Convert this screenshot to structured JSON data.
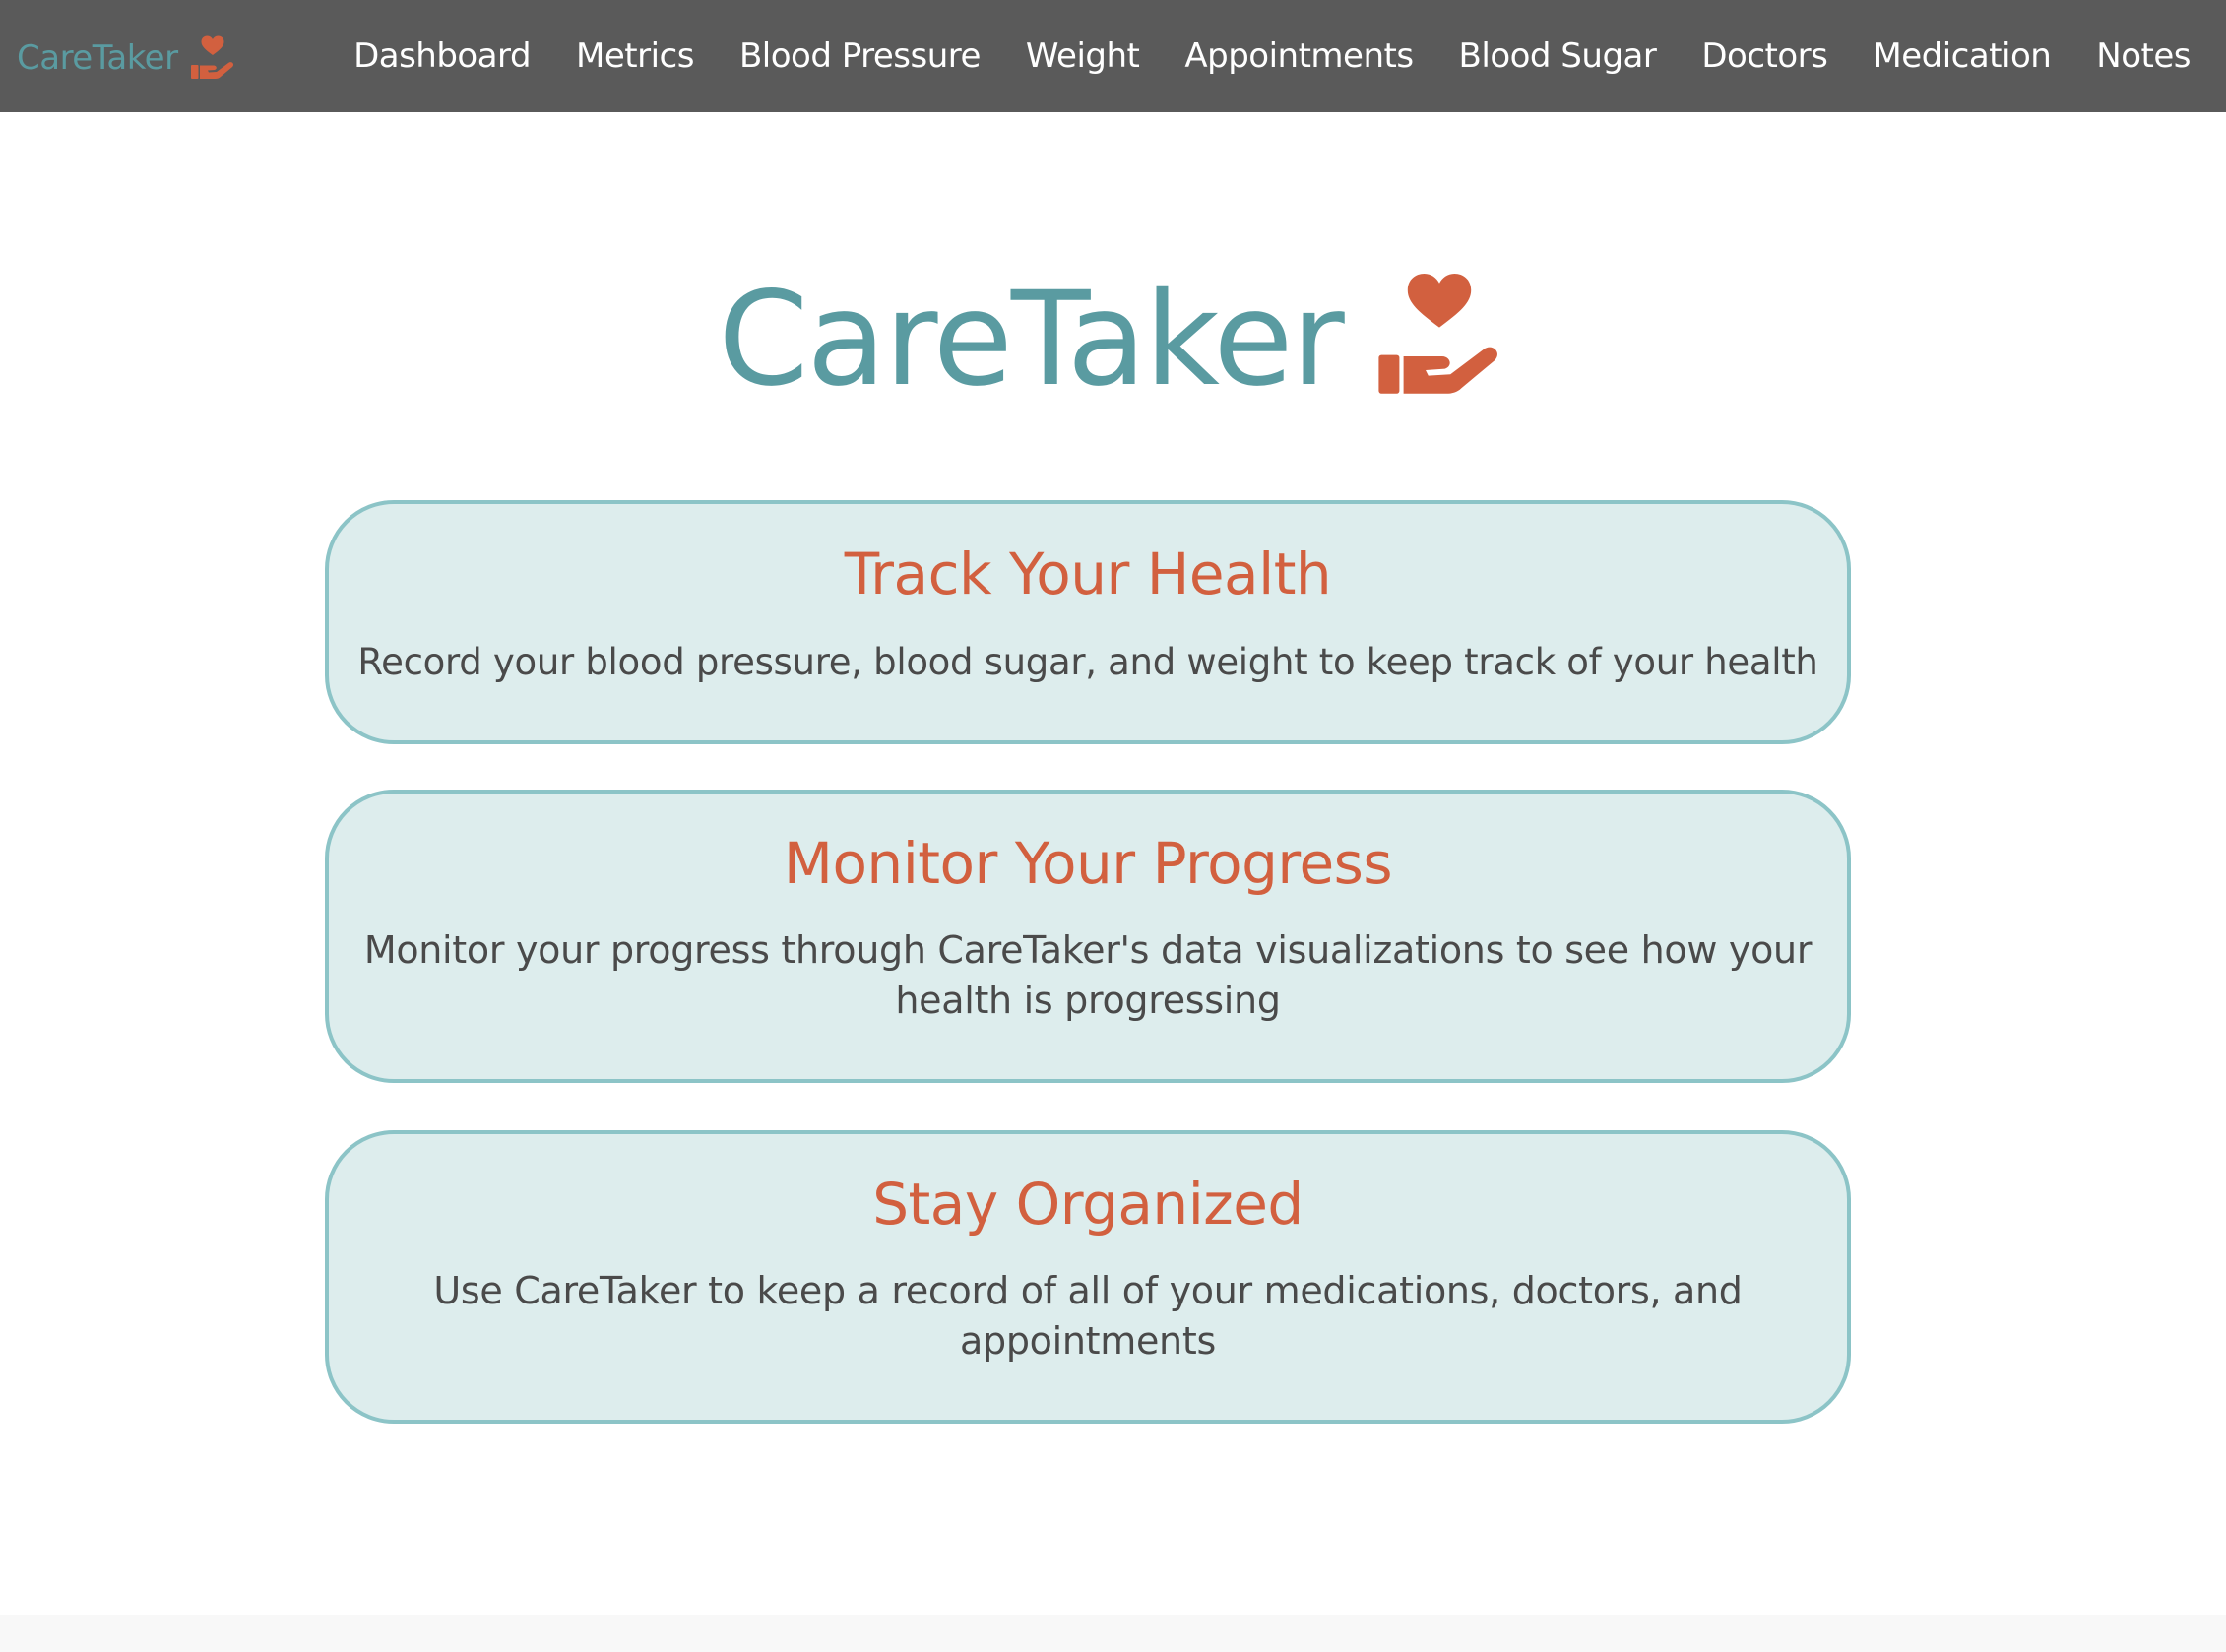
{
  "nav": {
    "brand": "CareTaker",
    "items": [
      {
        "id": "dashboard",
        "label": "Dashboard"
      },
      {
        "id": "metrics",
        "label": "Metrics"
      },
      {
        "id": "blood-pressure",
        "label": "Blood Pressure"
      },
      {
        "id": "weight",
        "label": "Weight"
      },
      {
        "id": "appointments",
        "label": "Appointments"
      },
      {
        "id": "blood-sugar",
        "label": "Blood Sugar"
      },
      {
        "id": "doctors",
        "label": "Doctors"
      },
      {
        "id": "medication",
        "label": "Medication"
      },
      {
        "id": "notes",
        "label": "Notes"
      }
    ]
  },
  "hero": {
    "title": "CareTaker",
    "icon": "hand-holding-heart-icon"
  },
  "features": [
    {
      "title": "Track Your Health",
      "text": "Record your blood pressure, blood sugar, and weight to keep track of your health"
    },
    {
      "title": "Monitor Your Progress",
      "text": "Monitor your progress through CareTaker's data visualizations to see how your health is progressing"
    },
    {
      "title": "Stay Organized",
      "text": "Use CareTaker to keep a record of all of your medications, doctors, and appointments"
    }
  ],
  "colors": {
    "navbar_bg": "#5a5a5a",
    "brand_teal": "#5a9ba1",
    "accent_coral": "#d2603f",
    "card_bg": "#ddeded",
    "card_border": "#8cc4c7",
    "body_text": "#4a4a4a"
  }
}
